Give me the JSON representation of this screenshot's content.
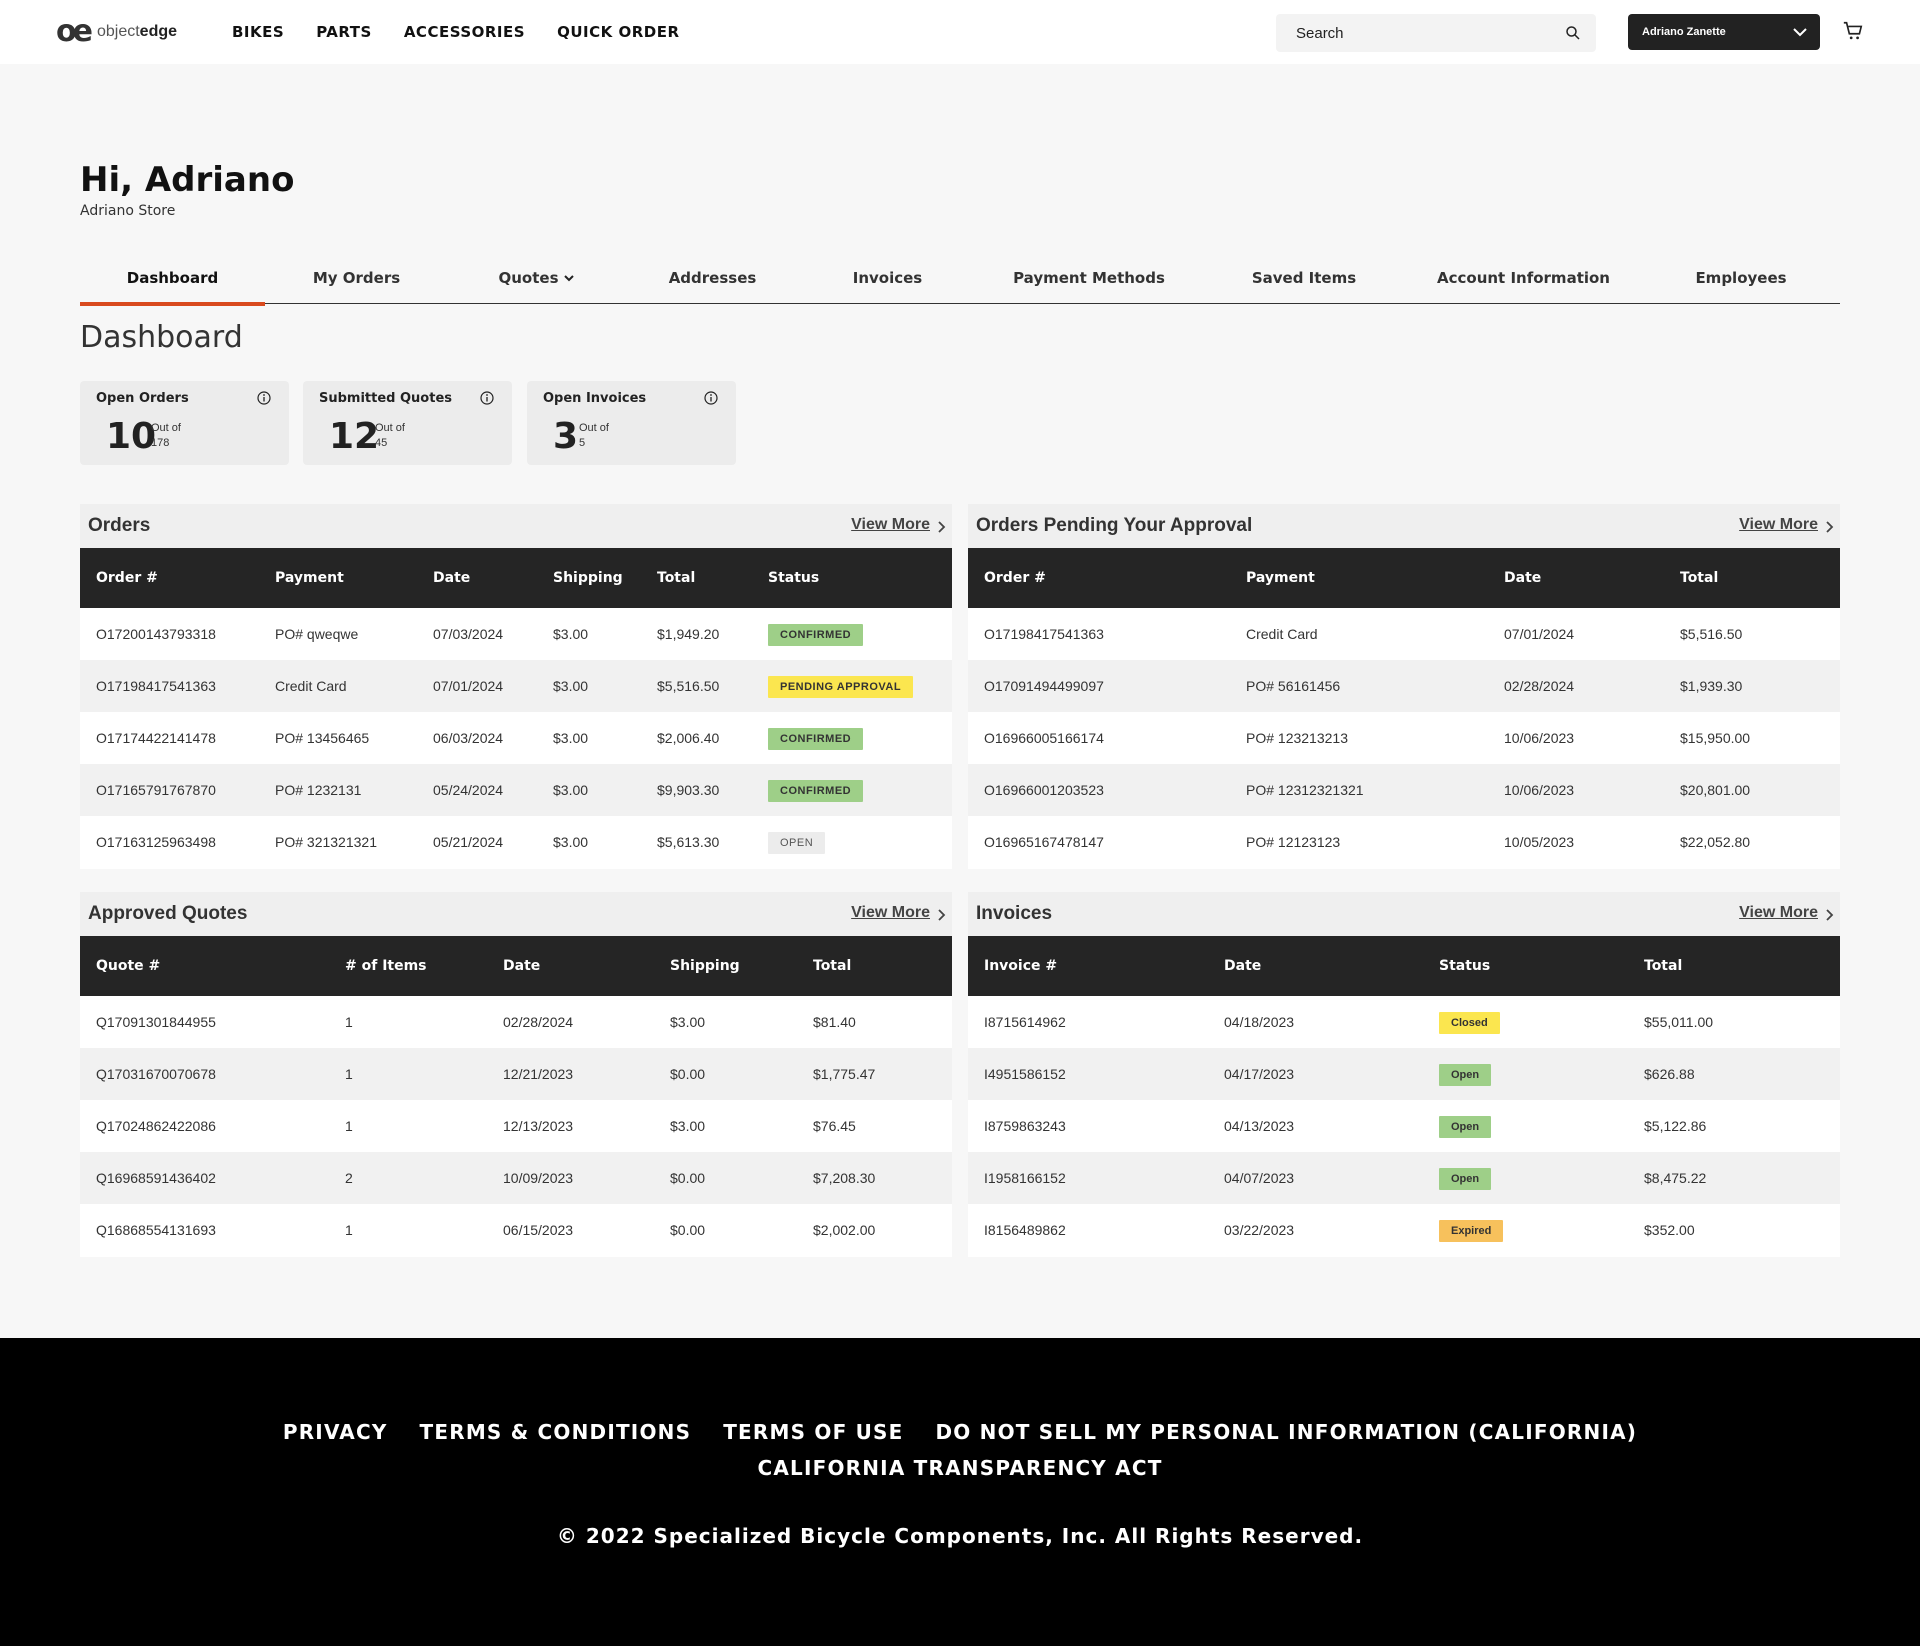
{
  "brand": {
    "mark": "oe",
    "text_light": "object",
    "text_bold": "edge"
  },
  "nav": [
    "BIKES",
    "PARTS",
    "ACCESSORIES",
    "QUICK ORDER"
  ],
  "search": {
    "placeholder": "Search"
  },
  "user": {
    "name": "Adriano Zanette"
  },
  "greeting": {
    "title": "Hi, Adriano",
    "store": "Adriano Store"
  },
  "tabs": [
    "Dashboard",
    "My Orders",
    "Quotes",
    "Addresses",
    "Invoices",
    "Payment Methods",
    "Saved Items",
    "Account Information",
    "Employees"
  ],
  "page_title": "Dashboard",
  "stats": [
    {
      "title": "Open Orders",
      "value": "10",
      "out_of_label": "Out of",
      "total": "178"
    },
    {
      "title": "Submitted Quotes",
      "value": "12",
      "out_of_label": "Out of",
      "total": "45"
    },
    {
      "title": "Open Invoices",
      "value": "3",
      "out_of_label": "Out of",
      "total": "5"
    }
  ],
  "view_more": "View More",
  "orders": {
    "title": "Orders",
    "headers": [
      "Order #",
      "Payment",
      "Date",
      "Shipping",
      "Total",
      "Status"
    ],
    "rows": [
      [
        "O17200143793318",
        "PO# qweqwe",
        "07/03/2024",
        "$3.00",
        "$1,949.20",
        "CONFIRMED"
      ],
      [
        "O17198417541363",
        "Credit Card",
        "07/01/2024",
        "$3.00",
        "$5,516.50",
        "PENDING APPROVAL"
      ],
      [
        "O17174422141478",
        "PO# 13456465",
        "06/03/2024",
        "$3.00",
        "$2,006.40",
        "CONFIRMED"
      ],
      [
        "O17165791767870",
        "PO# 1232131",
        "05/24/2024",
        "$3.00",
        "$9,903.30",
        "CONFIRMED"
      ],
      [
        "O17163125963498",
        "PO# 321321321",
        "05/21/2024",
        "$3.00",
        "$5,613.30",
        "OPEN"
      ]
    ]
  },
  "pending": {
    "title": "Orders Pending Your Approval",
    "headers": [
      "Order #",
      "Payment",
      "Date",
      "Total"
    ],
    "rows": [
      [
        "O17198417541363",
        "Credit Card",
        "07/01/2024",
        "$5,516.50"
      ],
      [
        "O17091494499097",
        "PO# 56161456",
        "02/28/2024",
        "$1,939.30"
      ],
      [
        "O16966005166174",
        "PO# 123213213",
        "10/06/2023",
        "$15,950.00"
      ],
      [
        "O16966001203523",
        "PO# 12312321321",
        "10/06/2023",
        "$20,801.00"
      ],
      [
        "O16965167478147",
        "PO# 12123123",
        "10/05/2023",
        "$22,052.80"
      ]
    ]
  },
  "quotes": {
    "title": "Approved Quotes",
    "headers": [
      "Quote #",
      "# of Items",
      "Date",
      "Shipping",
      "Total"
    ],
    "rows": [
      [
        "Q17091301844955",
        "1",
        "02/28/2024",
        "$3.00",
        "$81.40"
      ],
      [
        "Q17031670070678",
        "1",
        "12/21/2023",
        "$0.00",
        "$1,775.47"
      ],
      [
        "Q17024862422086",
        "1",
        "12/13/2023",
        "$3.00",
        "$76.45"
      ],
      [
        "Q16968591436402",
        "2",
        "10/09/2023",
        "$0.00",
        "$7,208.30"
      ],
      [
        "Q16868554131693",
        "1",
        "06/15/2023",
        "$0.00",
        "$2,002.00"
      ]
    ]
  },
  "invoices": {
    "title": "Invoices",
    "headers": [
      "Invoice #",
      "Date",
      "Status",
      "Total"
    ],
    "rows": [
      [
        "I8715614962",
        "04/18/2023",
        "Closed",
        "$55,011.00"
      ],
      [
        "I4951586152",
        "04/17/2023",
        "Open",
        "$626.88"
      ],
      [
        "I8759863243",
        "04/13/2023",
        "Open",
        "$5,122.86"
      ],
      [
        "I1958166152",
        "04/07/2023",
        "Open",
        "$8,475.22"
      ],
      [
        "I8156489862",
        "03/22/2023",
        "Expired",
        "$352.00"
      ]
    ]
  },
  "status_colors": {
    "confirmed": "#9ecf88",
    "pending": "#fbe64f",
    "open": "#ececec",
    "expired": "#f7c15c",
    "accent": "#d94a1e"
  },
  "footer": {
    "links": [
      "PRIVACY",
      "TERMS & CONDITIONS",
      "TERMS OF USE",
      "DO NOT SELL MY PERSONAL INFORMATION (CALIFORNIA)"
    ],
    "link2": "CALIFORNIA TRANSPARENCY ACT",
    "copyright": "© 2022 Specialized Bicycle Components, Inc. All Rights Reserved."
  }
}
